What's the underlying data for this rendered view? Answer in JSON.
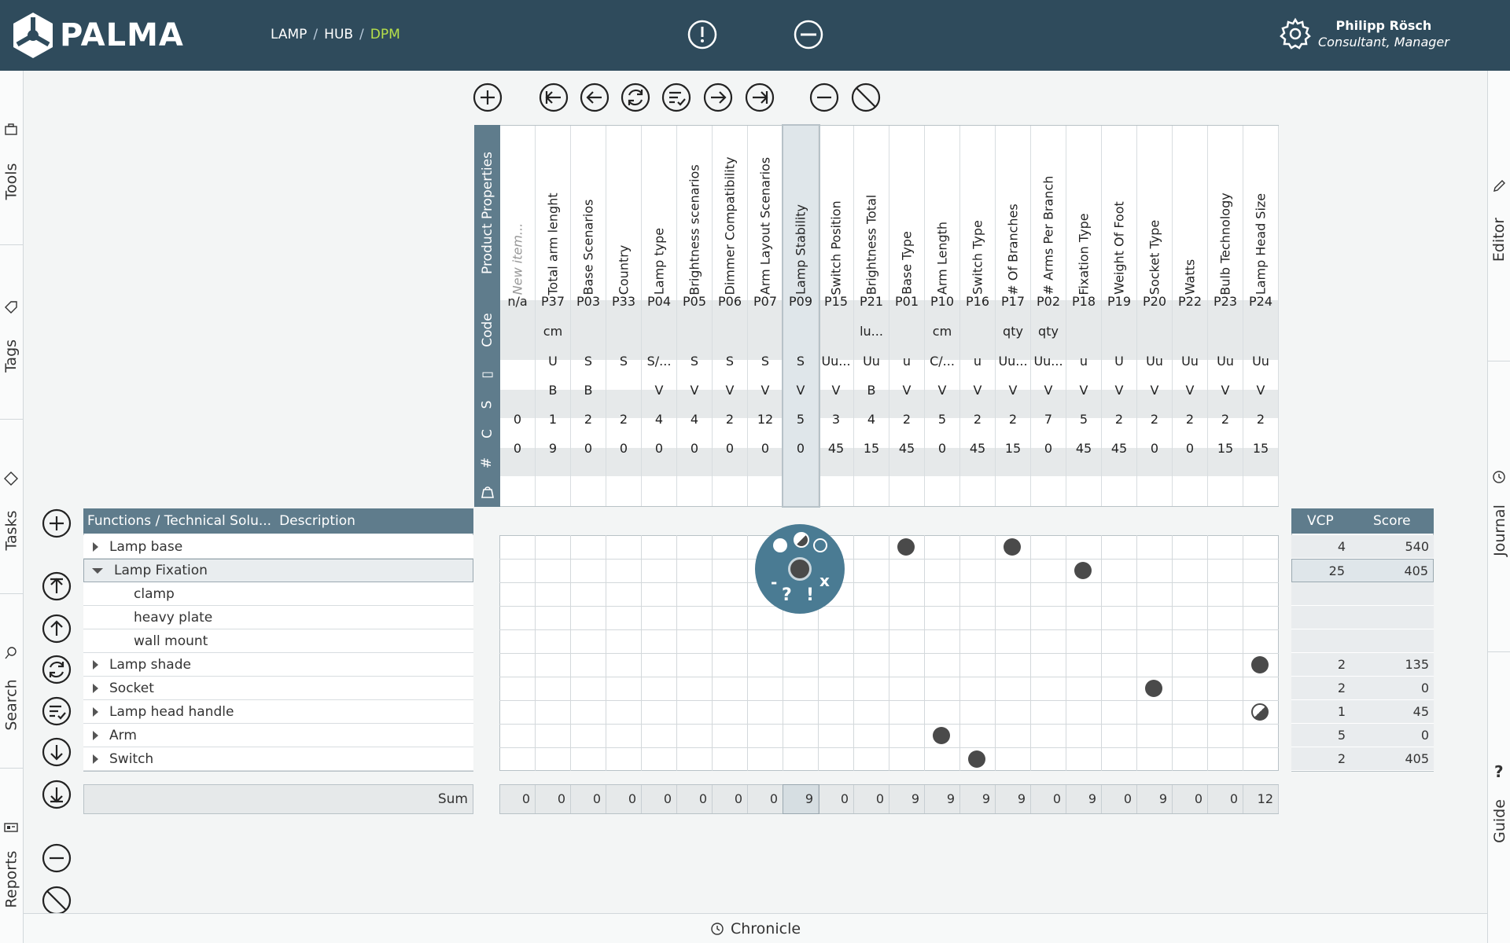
{
  "app": {
    "name": "PALMA"
  },
  "breadcrumb": {
    "items": [
      "LAMP",
      "HUB",
      "DPM"
    ],
    "separator": "/"
  },
  "header": {
    "warning_icon": "exclamation-circle-icon",
    "minus_icon": "minus-circle-icon"
  },
  "user": {
    "name": "Philipp Rösch",
    "role": "Consultant, Manager"
  },
  "left_rail": {
    "tabs": [
      "Tools",
      "Tags",
      "Tasks",
      "Search",
      "Reports"
    ]
  },
  "right_rail": {
    "tabs": [
      "Editor",
      "Journal",
      "Guide"
    ]
  },
  "bottom_bar": {
    "label": "Chronicle"
  },
  "header_rows": {
    "properties": "Product Properties",
    "code": "Code",
    "unit": "▯",
    "s": "S",
    "c": "C",
    "count": "#",
    "bag": "bag-icon"
  },
  "columns": [
    {
      "name": "New item...",
      "code": "n/a",
      "unit": "",
      "s": "",
      "c": "",
      "n": "0",
      "w": "0",
      "placeholder": true
    },
    {
      "name": "Total arm lenght",
      "code": "P37",
      "unit": "cm",
      "s": "U",
      "c": "B",
      "n": "1",
      "w": "9"
    },
    {
      "name": "Base Scenarios",
      "code": "P03",
      "unit": "",
      "s": "S",
      "c": "B",
      "n": "2",
      "w": "0"
    },
    {
      "name": "Country",
      "code": "P33",
      "unit": "",
      "s": "S",
      "c": "",
      "n": "2",
      "w": "0"
    },
    {
      "name": "Lamp type",
      "code": "P04",
      "unit": "",
      "s": "S/...",
      "c": "V",
      "n": "4",
      "w": "0"
    },
    {
      "name": "Brightness scenarios",
      "code": "P05",
      "unit": "",
      "s": "S",
      "c": "V",
      "n": "4",
      "w": "0"
    },
    {
      "name": "Dimmer Compatibility",
      "code": "P06",
      "unit": "",
      "s": "S",
      "c": "V",
      "n": "2",
      "w": "0"
    },
    {
      "name": "Arm Layout Scenarios",
      "code": "P07",
      "unit": "",
      "s": "S",
      "c": "V",
      "n": "12",
      "w": "0"
    },
    {
      "name": "Lamp Stability",
      "code": "P09",
      "unit": "",
      "s": "S",
      "c": "V",
      "n": "5",
      "w": "0",
      "selected": true
    },
    {
      "name": "Switch Position",
      "code": "P15",
      "unit": "",
      "s": "Uu...",
      "c": "V",
      "n": "3",
      "w": "45"
    },
    {
      "name": "Brightness Total",
      "code": "P21",
      "unit": "lu...",
      "s": "Uu",
      "c": "B",
      "n": "4",
      "w": "15"
    },
    {
      "name": "Base Type",
      "code": "P01",
      "unit": "",
      "s": "u",
      "c": "V",
      "n": "2",
      "w": "45"
    },
    {
      "name": "Arm Length",
      "code": "P10",
      "unit": "cm",
      "s": "C/...",
      "c": "V",
      "n": "5",
      "w": "0"
    },
    {
      "name": "Switch Type",
      "code": "P16",
      "unit": "",
      "s": "u",
      "c": "V",
      "n": "2",
      "w": "45"
    },
    {
      "name": "# Of Branches",
      "code": "P17",
      "unit": "qty",
      "s": "Uu...",
      "c": "V",
      "n": "2",
      "w": "15"
    },
    {
      "name": "# Arms Per Branch",
      "code": "P02",
      "unit": "qty",
      "s": "Uu...",
      "c": "V",
      "n": "7",
      "w": "0"
    },
    {
      "name": "Fixation Type",
      "code": "P18",
      "unit": "",
      "s": "u",
      "c": "V",
      "n": "5",
      "w": "45"
    },
    {
      "name": "Weight Of Foot",
      "code": "P19",
      "unit": "",
      "s": "U",
      "c": "V",
      "n": "2",
      "w": "45"
    },
    {
      "name": "Socket Type",
      "code": "P20",
      "unit": "",
      "s": "Uu",
      "c": "V",
      "n": "2",
      "w": "0"
    },
    {
      "name": "Watts",
      "code": "P22",
      "unit": "",
      "s": "Uu",
      "c": "V",
      "n": "2",
      "w": "0"
    },
    {
      "name": "Bulb Technology",
      "code": "P23",
      "unit": "",
      "s": "Uu",
      "c": "V",
      "n": "2",
      "w": "15"
    },
    {
      "name": "Lamp Head Size",
      "code": "P24",
      "unit": "",
      "s": "Uu",
      "c": "V",
      "n": "2",
      "w": "15"
    }
  ],
  "tree": {
    "header_functions": "Functions / Technical Solu...",
    "header_description": "Description",
    "rows": [
      {
        "label": "Lamp base",
        "level": 0,
        "expanded": false
      },
      {
        "label": "Lamp Fixation",
        "level": 0,
        "expanded": true,
        "selected": true
      },
      {
        "label": "clamp",
        "level": 1
      },
      {
        "label": "heavy plate",
        "level": 1
      },
      {
        "label": "wall mount",
        "level": 1
      },
      {
        "label": "Lamp shade",
        "level": 0,
        "expanded": false
      },
      {
        "label": "Socket",
        "level": 0,
        "expanded": false
      },
      {
        "label": "Lamp head handle",
        "level": 0,
        "expanded": false
      },
      {
        "label": "Arm",
        "level": 0,
        "expanded": false
      },
      {
        "label": "Switch",
        "level": 0,
        "expanded": false
      }
    ],
    "sum_label": "Sum"
  },
  "matrix_marks": [
    {
      "row": 0,
      "col": 11,
      "kind": "full"
    },
    {
      "row": 0,
      "col": 14,
      "kind": "full"
    },
    {
      "row": 1,
      "col": 16,
      "kind": "full"
    },
    {
      "row": 5,
      "col": 21,
      "kind": "full"
    },
    {
      "row": 6,
      "col": 18,
      "kind": "full"
    },
    {
      "row": 7,
      "col": 21,
      "kind": "half"
    },
    {
      "row": 8,
      "col": 12,
      "kind": "full"
    },
    {
      "row": 9,
      "col": 13,
      "kind": "full"
    }
  ],
  "radial_menu": {
    "labels": [
      "-",
      "?",
      "!",
      "x"
    ]
  },
  "vcp": {
    "header_vcp": "VCP",
    "header_score": "Score",
    "rows": [
      {
        "vcp": "4",
        "score": "540"
      },
      {
        "vcp": "25",
        "score": "405"
      },
      {
        "vcp": "",
        "score": ""
      },
      {
        "vcp": "",
        "score": ""
      },
      {
        "vcp": "",
        "score": ""
      },
      {
        "vcp": "2",
        "score": "135"
      },
      {
        "vcp": "2",
        "score": "0"
      },
      {
        "vcp": "1",
        "score": "45"
      },
      {
        "vcp": "5",
        "score": "0"
      },
      {
        "vcp": "2",
        "score": "405"
      }
    ]
  },
  "sums": [
    "0",
    "0",
    "0",
    "0",
    "0",
    "0",
    "0",
    "0",
    "9",
    "0",
    "0",
    "9",
    "9",
    "9",
    "9",
    "0",
    "9",
    "0",
    "9",
    "0",
    "0",
    "12"
  ],
  "colors": {
    "header_bg": "#2f4b5c",
    "accent": "#b6e04a",
    "row_label_bg": "#5f7c8c",
    "radial_bg": "#4a7b93"
  }
}
